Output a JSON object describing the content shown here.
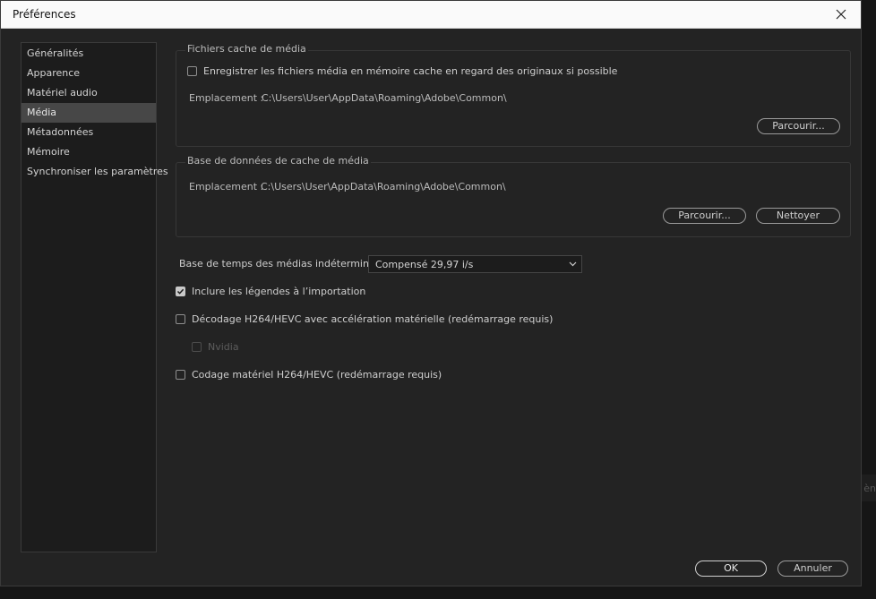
{
  "background": {
    "edge_text": "èn"
  },
  "dialog": {
    "title": "Préférences",
    "close_glyph": "✕"
  },
  "sidebar": {
    "items": [
      {
        "label": "Généralités",
        "selected": false
      },
      {
        "label": "Apparence",
        "selected": false
      },
      {
        "label": "Matériel audio",
        "selected": false
      },
      {
        "label": "Média",
        "selected": true
      },
      {
        "label": "Métadonnées",
        "selected": false
      },
      {
        "label": "Mémoire",
        "selected": false
      },
      {
        "label": "Synchroniser les paramètres",
        "selected": false
      }
    ]
  },
  "media_cache_files": {
    "title": "Fichiers cache de média",
    "save_next_to_originals": {
      "label": "Enregistrer les fichiers média en mémoire cache en regard des originaux si possible",
      "checked": false
    },
    "location_label": "Emplacement :",
    "location_path": "C:\\Users\\User\\AppData\\Roaming\\Adobe\\Common\\",
    "browse_label": "Parcourir..."
  },
  "media_cache_db": {
    "title": "Base de données de cache de média",
    "location_label": "Emplacement :",
    "location_path": "C:\\Users\\User\\AppData\\Roaming\\Adobe\\Common\\",
    "browse_label": "Parcourir...",
    "clean_label": "Nettoyer"
  },
  "timebase": {
    "label": "Base de temps des médias indéterminée :",
    "value": "Compensé 29,97 i/s"
  },
  "options": {
    "include_captions": {
      "label": "Inclure les légendes à l’importation",
      "checked": true
    },
    "hw_decoding": {
      "label": "Décodage H264/HEVC avec accélération matérielle (redémarrage requis)",
      "checked": false
    },
    "nvidia": {
      "label": "Nvidia",
      "checked": false,
      "disabled": true
    },
    "hw_encoding": {
      "label": "Codage matériel H264/HEVC (redémarrage requis)",
      "checked": false
    }
  },
  "footer": {
    "ok_label": "OK",
    "cancel_label": "Annuler"
  },
  "colors": {
    "dialog_bg": "#232323",
    "titlebar_bg": "#fafafa",
    "selected_item_bg": "#474747"
  }
}
